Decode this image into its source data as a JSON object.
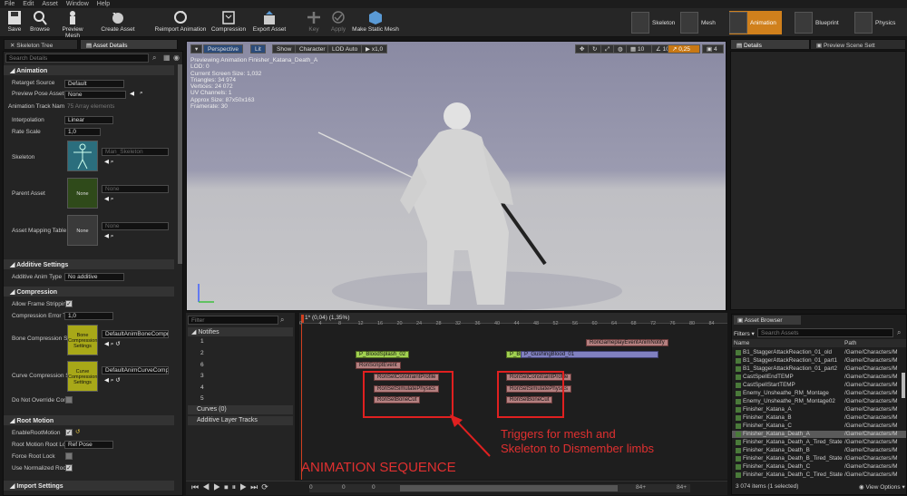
{
  "menu": [
    "File",
    "Edit",
    "Asset",
    "Window",
    "Help"
  ],
  "toolbar": {
    "save": "Save",
    "browse": "Browse",
    "preview_mesh": "Preview Mesh",
    "create_asset": "Create Asset",
    "reimport": "Reimport Animation",
    "compression": "Compression",
    "export": "Export Asset",
    "key": "Key",
    "apply": "Apply",
    "make_static": "Make Static Mesh"
  },
  "modes": {
    "skeleton": "Skeleton",
    "mesh": "Mesh",
    "animation": "Animation",
    "blueprint": "Blueprint",
    "physics": "Physics"
  },
  "tabs": {
    "skeleton_tree": "Skeleton Tree",
    "asset_details": "Asset Details",
    "details": "Details",
    "preview_scene": "Preview Scene Sett",
    "asset_browser": "Asset Browser"
  },
  "details": {
    "search_placeholder": "Search Details",
    "animation_cat": "Animation",
    "retarget_label": "Retarget Source",
    "retarget_value": "Default",
    "preview_pose_label": "Preview Pose Asset",
    "preview_pose_value": "None",
    "track_names_label": "Animation Track Nam",
    "track_names_value": "75 Array elements",
    "interpolation_label": "Interpolation",
    "interpolation_value": "Linear",
    "rate_scale_label": "Rate Scale",
    "rate_scale_value": "1,0",
    "skeleton_label": "Skeleton",
    "skeleton_value": "Man_Skeleton",
    "parent_label": "Parent Asset",
    "parent_value": "None",
    "parent_thumb": "None",
    "mapping_label": "Asset Mapping Table",
    "mapping_value": "None",
    "mapping_thumb": "None",
    "additive_cat": "Additive Settings",
    "additive_type_label": "Additive Anim Type",
    "additive_type_value": "No additive",
    "compression_cat": "Compression",
    "allow_strip_label": "Allow Frame Stripping",
    "comp_error_label": "Compression Error Th",
    "comp_error_value": "1,0",
    "bone_comp_label": "Bone Compression Se",
    "bone_comp_value": "DefaultAnimBoneCompre",
    "bone_comp_thumb": "Bone Compression Settings",
    "curve_comp_label": "Curve Compression S",
    "curve_comp_value": "DefaultAnimCurveCompre",
    "curve_comp_thumb": "Curve Compression Settings",
    "no_override_label": "Do Not Override Comp",
    "root_cat": "Root Motion",
    "enable_root_label": "EnableRootMotion",
    "root_lock_label": "Root Motion Root Loc",
    "root_lock_value": "Ref Pose",
    "force_lock_label": "Force Root Lock",
    "use_norm_label": "Use Normalized Root",
    "import_cat": "Import Settings"
  },
  "viewport": {
    "perspective": "Perspective",
    "lit": "Lit",
    "show": "Show",
    "character": "Character",
    "lod": "LOD Auto",
    "speed": "x1,0",
    "grid_val": "10",
    "angle_val": "10°",
    "scale_val": "0,25",
    "cam_val": "4",
    "stats": [
      "Previewing Animation Finisher_Katana_Death_A",
      "LOD: 0",
      "Current Screen Size: 1,032",
      "Triangles: 34 974",
      "Vertices: 24 072",
      "UV Channels: 1",
      "Approx Size: 87x50x163",
      "Framerate: 30"
    ]
  },
  "timeline": {
    "filter_placeholder": "Filter",
    "notifies": "Notifies",
    "tracks": [
      "1",
      "2",
      "6",
      "3",
      "4",
      "5"
    ],
    "curves": "Curves",
    "curves_count": "(0)",
    "additive_tracks": "Additive Layer Tracks",
    "frame_info": "1* (0,04) (1,35%)",
    "ruler": [
      "0",
      "4",
      "8",
      "12",
      "16",
      "20",
      "24",
      "28",
      "32",
      "36",
      "40",
      "44",
      "48",
      "52",
      "56",
      "60",
      "64",
      "68",
      "72",
      "76",
      "80",
      "84"
    ],
    "notifies_left": [
      "P_BloodSplash_02",
      "RonScriptEvent",
      "RonSetConstraintProfile",
      "RonSetSimulatePhysics",
      "RonSetBoneCut"
    ],
    "notifies_right": [
      "P_Bl",
      "P_GushingBlood_01",
      "RonSetConstraintProfile",
      "RonSetSimulatePhysics",
      "RonSetBoneCut"
    ],
    "gameplay_notify": "RonGameplayEventAnimNotify",
    "bottom_nums": [
      "0",
      "0",
      "0",
      "0",
      "84+",
      "84+"
    ]
  },
  "annotations": {
    "triggers": "Triggers for mesh and Skeleton to Dismember limbs",
    "sequence": "ANIMATION SEQUENCE"
  },
  "asset_browser": {
    "filters": "Filters",
    "search_placeholder": "Search Assets",
    "col_name": "Name",
    "col_path": "Path",
    "rows": [
      {
        "name": "B1_StaggerAttackReaction_01_old",
        "path": "/Game/Characters/M"
      },
      {
        "name": "B1_StaggerAttackReaction_01_part1",
        "path": "/Game/Characters/M"
      },
      {
        "name": "B1_StaggerAttackReaction_01_part2",
        "path": "/Game/Characters/M"
      },
      {
        "name": "CastSpellEndTEMP",
        "path": "/Game/Characters/M"
      },
      {
        "name": "CastSpellStartTEMP",
        "path": "/Game/Characters/M"
      },
      {
        "name": "Enemy_Unsheathe_RM_Montage",
        "path": "/Game/Characters/M"
      },
      {
        "name": "Enemy_Unsheathe_RM_Montage02",
        "path": "/Game/Characters/M"
      },
      {
        "name": "Finisher_Katana_A",
        "path": "/Game/Characters/M"
      },
      {
        "name": "Finisher_Katana_B",
        "path": "/Game/Characters/M"
      },
      {
        "name": "Finisher_Katana_C",
        "path": "/Game/Characters/M"
      },
      {
        "name": "Finisher_Katana_Death_A",
        "path": "/Game/Characters/M"
      },
      {
        "name": "Finisher_Katana_Death_A_Tired_State",
        "path": "/Game/Characters/M"
      },
      {
        "name": "Finisher_Katana_Death_B",
        "path": "/Game/Characters/M"
      },
      {
        "name": "Finisher_Katana_Death_B_Tired_State",
        "path": "/Game/Characters/M"
      },
      {
        "name": "Finisher_Katana_Death_C",
        "path": "/Game/Characters/M"
      },
      {
        "name": "Finisher_Katana_Death_C_Tired_State",
        "path": "/Game/Characters/M"
      }
    ],
    "count": "3 074 items (1 selected)",
    "view_options": "View Options"
  }
}
